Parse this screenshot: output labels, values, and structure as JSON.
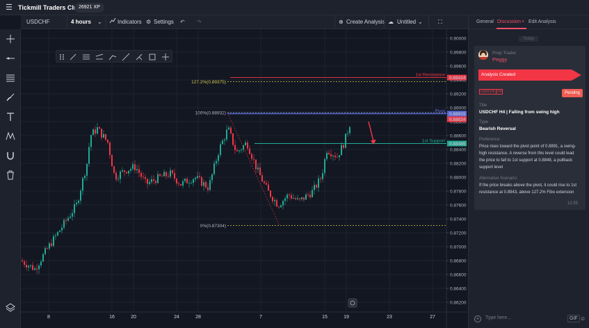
{
  "topbar": {
    "app_name": "Tickmill Traders Club",
    "xp_badge": "26921 XP"
  },
  "toolbar": {
    "symbol": "USDCHF",
    "interval": "4 hours",
    "indicators": "Indicators",
    "settings": "Settings",
    "create_analysis": "Create Analysis",
    "layout_name": "Untitled"
  },
  "chart_data": {
    "type": "candlestick",
    "symbol": "USDCHF",
    "timeframe": "4 hours",
    "y_ticks": [
      "0.90000",
      "0.89800",
      "0.89600",
      "0.89400",
      "0.89200",
      "0.89000",
      "0.88800",
      "0.88600",
      "0.88400",
      "0.88200",
      "0.88000",
      "0.87800",
      "0.87600",
      "0.87400",
      "0.87200",
      "0.87000",
      "0.86800",
      "0.86600",
      "0.86400",
      "0.86200"
    ],
    "x_ticks": [
      "8",
      "16",
      "20",
      "24",
      "28",
      "7",
      "15",
      "19",
      "23",
      "27"
    ],
    "price_labels": [
      {
        "price": "0.89434",
        "color": "#f23645"
      },
      {
        "price": "0.88915",
        "color": "#5b6bd8"
      },
      {
        "price": "0.88834",
        "color": "#f23645"
      },
      {
        "price": "0.88485",
        "color": "#22ab94"
      }
    ],
    "levels": [
      {
        "name": "1st Resistance",
        "price": 0.89434,
        "color": "#f23645"
      },
      {
        "name": "Pivot",
        "price": 0.88915,
        "color": "#5b6bd8"
      },
      {
        "name": "1st Support",
        "price": 0.88485,
        "color": "#22ab94"
      }
    ],
    "fib_labels": [
      "127.2%(0.89375)",
      "100%(0.88932)",
      "0%(0.87304)"
    ],
    "fib_prices": [
      0.89375,
      0.88932,
      0.87304
    ],
    "y_range": [
      0.8617,
      0.9009
    ],
    "colors": {
      "up": "#22ab94",
      "down": "#f23645",
      "fib": "#d1c64a",
      "arrow": "#f23645"
    }
  },
  "panel": {
    "tabs": [
      "General",
      "Discussion",
      "Edit Analysis"
    ],
    "close_icon": "×",
    "today": "Today",
    "author_role": "Prop Trader",
    "author_name": "Peggy",
    "event": "Analysis Created",
    "tags": [
      "USDCHF",
      "H4"
    ],
    "status": "Pending",
    "title_label": "Title",
    "title_value": "USDCHF H4 | Falling from swing high",
    "type_label": "Type",
    "type_value": "Bearish Reversal",
    "pref_label": "Preference:",
    "pref_text": "Price rises toward the pivot point of 0.8891, a swing-high resistance. A reverse from this level could lead the price to fall to 1st support at 0.8848, a pullback support level",
    "alt_label": "Alternative Scenario:",
    "alt_text": "If the price breaks above the pivot, it could rise to 1st resistance at 0.8943, above 127.2% Fibo extension",
    "time": "12:55",
    "reply_placeholder": "Type here...",
    "gif": "GIF"
  }
}
